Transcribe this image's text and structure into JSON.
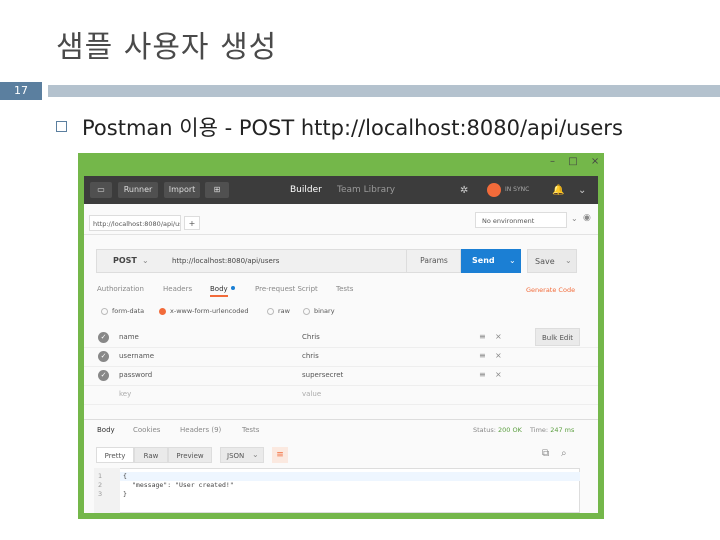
{
  "slide": {
    "title": "샘플 사용자 생성",
    "number": "17",
    "bullet": "Postman 이용 - POST http://localhost:8080/api/users"
  },
  "window": {
    "min": "–",
    "max": "□",
    "close": "×"
  },
  "postman": {
    "toolbar": {
      "runner": "Runner",
      "import": "Import",
      "builder": "Builder",
      "team_library": "Team Library",
      "sync_status": "IN SYNC"
    },
    "tab_url": "http://localhost:8080/api/us",
    "tab_add": "+",
    "environment": "No environment",
    "request": {
      "method": "POST",
      "url": "http://localhost:8080/api/users",
      "params": "Params",
      "send": "Send",
      "save": "Save"
    },
    "request_tabs": [
      "Authorization",
      "Headers",
      "Body",
      "Pre-request Script",
      "Tests"
    ],
    "generate_code": "Generate Code",
    "body_types": [
      "form-data",
      "x-www-form-urlencoded",
      "raw",
      "binary"
    ],
    "rows": [
      {
        "key": "name",
        "value": "Chris"
      },
      {
        "key": "username",
        "value": "chris"
      },
      {
        "key": "password",
        "value": "supersecret"
      }
    ],
    "row_placeholder": {
      "key": "key",
      "value": "value"
    },
    "bulk_edit": "Bulk Edit",
    "response_tabs": [
      "Body",
      "Cookies",
      "Headers (9)",
      "Tests"
    ],
    "status_label": "Status:",
    "status_value": "200 OK",
    "time_label": "Time:",
    "time_value": "247 ms",
    "format_buttons": [
      "Pretty",
      "Raw",
      "Preview"
    ],
    "format_select": "JSON",
    "code_lines": [
      "1",
      "2",
      "3"
    ],
    "code": [
      "{",
      "\"message\": \"User created!\"",
      "}"
    ]
  }
}
